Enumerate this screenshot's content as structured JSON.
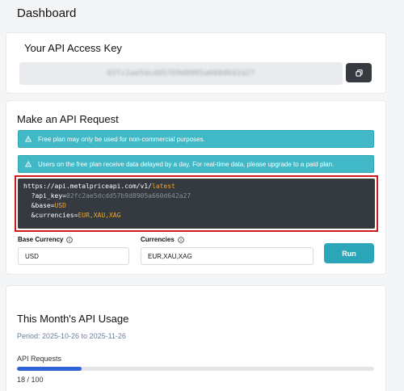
{
  "page": {
    "title": "Dashboard"
  },
  "api_key_card": {
    "title": "Your API Access Key",
    "key_value": "02fc2ae5dcdd57b9d8905a660d642a27",
    "copy_icon": "copy-icon"
  },
  "request_card": {
    "title": "Make an API Request",
    "alerts": [
      "Free plan may only be used for non-commercial purposes.",
      "Users on the free plan receive data delayed by a day. For real-time data, please upgrade to a paid plan."
    ],
    "code": {
      "base_url": "https://api.metalpriceapi.com/v1/",
      "endpoint": "latest",
      "api_key_param": "?api_key=",
      "api_key_value": "02fc2ae5dcdd57b9d8905a660d642a27",
      "base_param": "&base=",
      "base_value": "USD",
      "currencies_param": "&currencies=",
      "currencies_value": "EUR,XAU,XAG"
    },
    "base_currency_label": "Base Currency",
    "base_currency_value": "USD",
    "currencies_label": "Currencies",
    "currencies_value": "EUR,XAU,XAG",
    "run_label": "Run"
  },
  "usage_card": {
    "title": "This Month's API Usage",
    "period": "Period: 2025-10-26 to 2025-11-26",
    "requests_label": "API Requests",
    "used": 18,
    "limit": 100,
    "count_text": "18 / 100"
  },
  "colors": {
    "alert": "#40b8c6",
    "run_button": "#2aa6b8",
    "code_bg": "#343a40",
    "code_highlight": "#f5a623",
    "progress": "#2f62d6",
    "highlight_border": "#d01a1a"
  }
}
